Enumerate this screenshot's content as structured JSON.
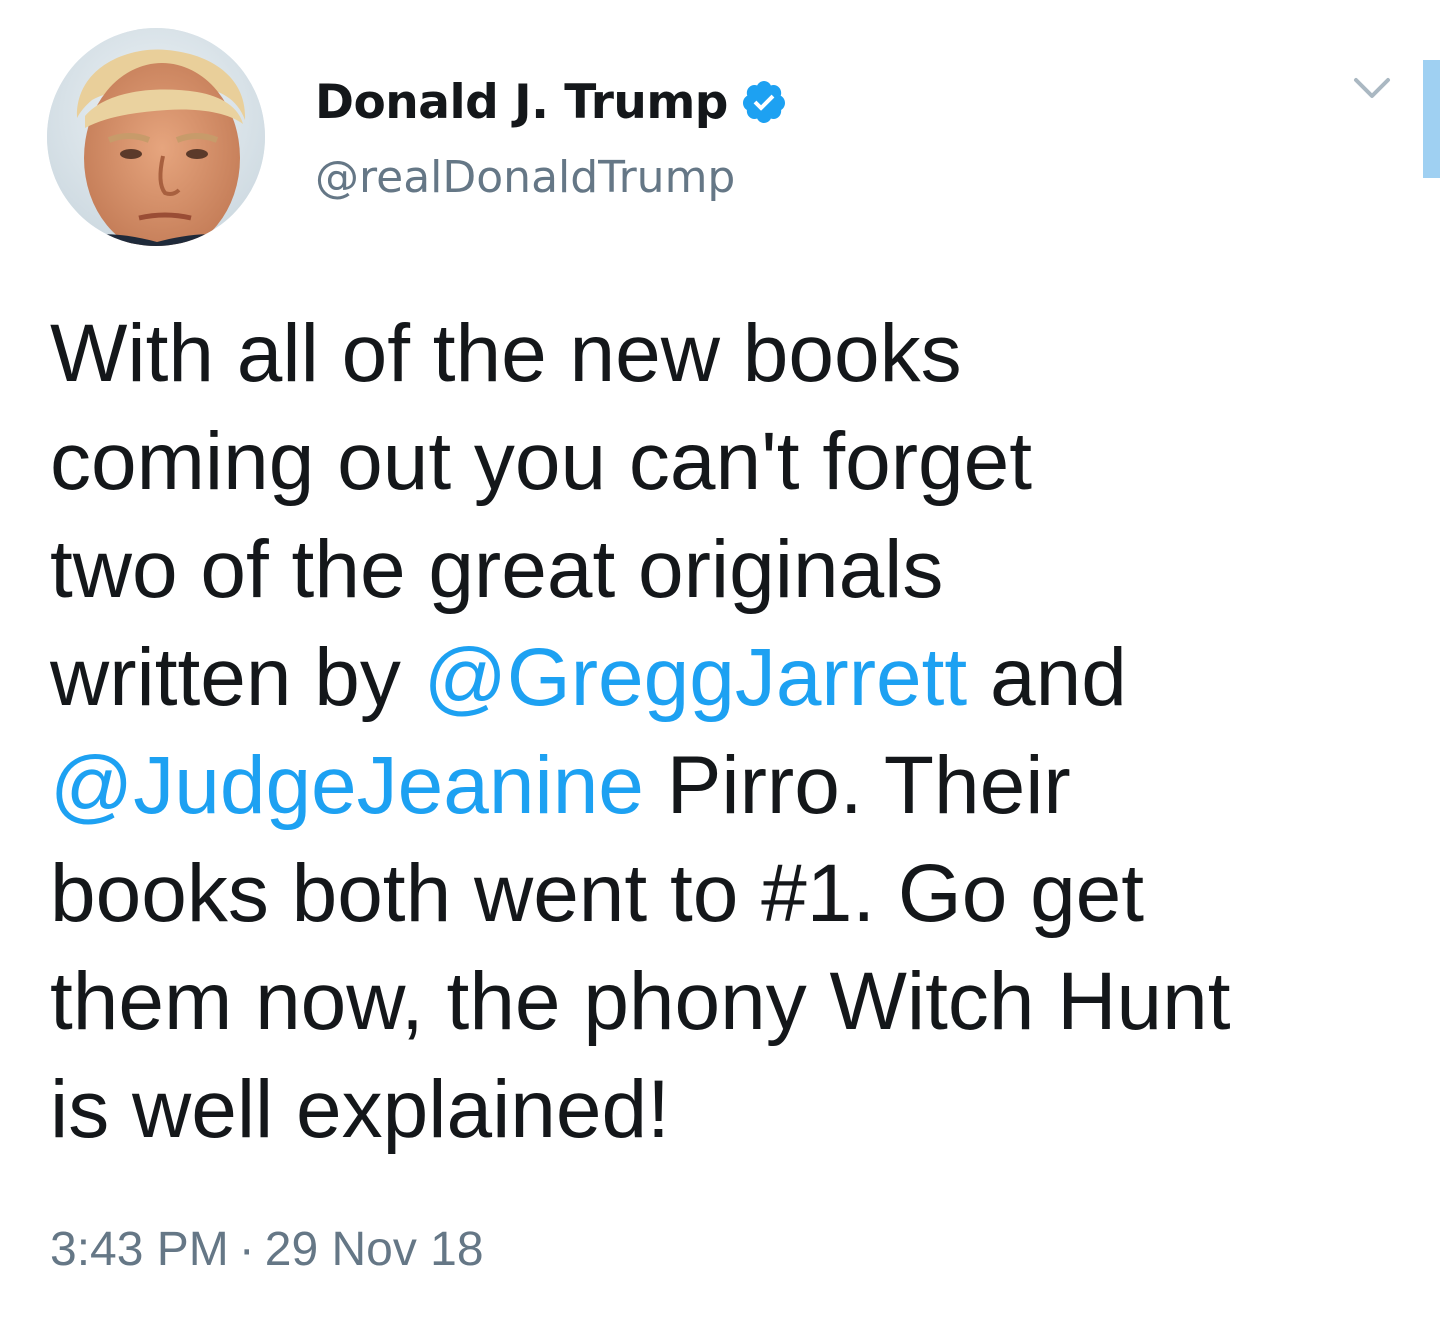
{
  "tweet": {
    "display_name": "Donald J. Trump",
    "handle": "@realDonaldTrump",
    "verified": true,
    "icons": {
      "verified": "verified-badge-icon",
      "menu": "chevron-down-icon"
    },
    "colors": {
      "accent": "#1da1f2",
      "text": "#14171a",
      "muted": "#657786"
    },
    "body": {
      "line1": "With all of the new books",
      "line2": "coming out you can't forget",
      "line3": "two of the great originals",
      "line4_a": "written by ",
      "mention1": "@GreggJarrett",
      "line4_b": " and",
      "mention2": "@JudgeJeanine",
      "line5_b": " Pirro. Their",
      "line6": "books both went to #1. Go get",
      "line7": "them now, the phony Witch Hunt",
      "line8": "is well explained!"
    },
    "time": "3:43 PM",
    "separator": "·",
    "date": "29 Nov 18"
  }
}
